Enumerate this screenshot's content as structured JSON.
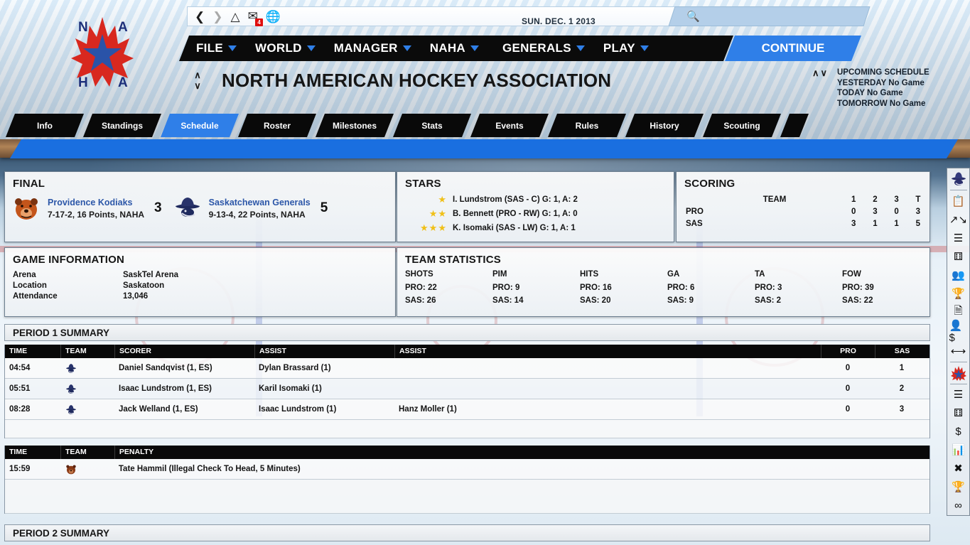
{
  "topbar": {
    "icons": [
      "back-arrow",
      "forward-arrow",
      "home",
      "mail",
      "globe"
    ],
    "mail_badge": "4",
    "date": "SUN. DEC. 1 2013",
    "search_placeholder": ""
  },
  "menu": {
    "items": [
      {
        "label": "FILE",
        "caret": true
      },
      {
        "label": "WORLD",
        "caret": true
      },
      {
        "label": "MANAGER",
        "caret": true
      },
      {
        "label": "NAHA",
        "caret": true
      },
      {
        "label": "GENERALS",
        "caret": true
      },
      {
        "label": "PLAY",
        "caret": true
      }
    ],
    "continue": "CONTINUE"
  },
  "header": {
    "title": "NORTH AMERICAN HOCKEY ASSOCIATION",
    "up_arrow": "∧",
    "down_arrow": "∨",
    "sched_arrows": "∧∨",
    "upcoming": {
      "title": "UPCOMING SCHEDULE",
      "yesterday": "YESTERDAY No Game",
      "today": "TODAY No Game",
      "tomorrow": "TOMORROW No Game"
    }
  },
  "tabs": [
    {
      "label": "Info",
      "active": false
    },
    {
      "label": "Standings",
      "active": false
    },
    {
      "label": "Schedule",
      "active": true
    },
    {
      "label": "Roster",
      "active": false
    },
    {
      "label": "Milestones",
      "active": false
    },
    {
      "label": "Stats",
      "active": false
    },
    {
      "label": "Events",
      "active": false
    },
    {
      "label": "Rules",
      "active": false
    },
    {
      "label": "History",
      "active": false
    },
    {
      "label": "Scouting",
      "active": false
    }
  ],
  "final": {
    "title": "FINAL",
    "away": {
      "name": "Providence Kodiaks",
      "record": "7-17-2, 16 Points, NAHA",
      "score": "3",
      "logo": "kodiaks-bear-logo"
    },
    "home": {
      "name": "Saskatchewan Generals",
      "record": "9-13-4, 22 Points, NAHA",
      "score": "5",
      "logo": "generals-cowboy-logo"
    }
  },
  "stars": {
    "title": "STARS",
    "rows": [
      {
        "stars": "★",
        "text": "I. Lundstrom (SAS - C)  G: 1,  A: 2"
      },
      {
        "stars": "★★",
        "text": "B. Bennett (PRO - RW)  G: 1,  A: 0"
      },
      {
        "stars": "★★★",
        "text": "K. Isomaki (SAS - LW)  G: 1,  A: 1"
      }
    ]
  },
  "scoring": {
    "title": "SCORING",
    "team_header": "TEAM",
    "period_headers": [
      "1",
      "2",
      "3",
      "T"
    ],
    "rows": [
      {
        "team": "PRO",
        "periods": [
          "0",
          "3",
          "0"
        ],
        "total": "3"
      },
      {
        "team": "SAS",
        "periods": [
          "3",
          "1",
          "1"
        ],
        "total": "5"
      }
    ]
  },
  "game_information": {
    "title": "GAME INFORMATION",
    "rows": [
      {
        "key": "Arena",
        "value": "SaskTel Arena"
      },
      {
        "key": "Location",
        "value": "Saskatoon"
      },
      {
        "key": "Attendance",
        "value": "13,046"
      }
    ]
  },
  "team_statistics": {
    "title": "TEAM STATISTICS",
    "columns": [
      {
        "head": "SHOTS",
        "pro": "PRO: 22",
        "sas": "SAS: 26"
      },
      {
        "head": "PIM",
        "pro": "PRO: 9",
        "sas": "SAS: 14"
      },
      {
        "head": "HITS",
        "pro": "PRO: 16",
        "sas": "SAS: 20"
      },
      {
        "head": "GA",
        "pro": "PRO: 6",
        "sas": "SAS: 9"
      },
      {
        "head": "TA",
        "pro": "PRO: 3",
        "sas": "SAS: 2"
      },
      {
        "head": "FOW",
        "pro": "PRO: 39",
        "sas": "SAS: 22"
      }
    ]
  },
  "period1": {
    "title": "PERIOD 1 SUMMARY",
    "goal_headers": {
      "time": "TIME",
      "team": "TEAM",
      "scorer": "SCORER",
      "assist1": "ASSIST",
      "assist2": "ASSIST",
      "pro": "PRO",
      "sas": "SAS"
    },
    "goals": [
      {
        "time": "04:54",
        "team_logo": "generals-cowboy-logo",
        "scorer": "Daniel Sandqvist (1, ES)",
        "assist1": "Dylan Brassard (1)",
        "assist2": "",
        "pro": "0",
        "sas": "1"
      },
      {
        "time": "05:51",
        "team_logo": "generals-cowboy-logo",
        "scorer": "Isaac Lundstrom (1, ES)",
        "assist1": "Karil Isomaki (1)",
        "assist2": "",
        "pro": "0",
        "sas": "2"
      },
      {
        "time": "08:28",
        "team_logo": "generals-cowboy-logo",
        "scorer": "Jack Welland (1, ES)",
        "assist1": "Isaac Lundstrom (1)",
        "assist2": "Hanz Moller (1)",
        "pro": "0",
        "sas": "3"
      }
    ],
    "penalty_headers": {
      "time": "TIME",
      "team": "TEAM",
      "penalty": "PENALTY"
    },
    "penalties": [
      {
        "time": "15:59",
        "team_logo": "kodiaks-bear-logo",
        "penalty": "Tate Hammil (Illegal Check To Head, 5 Minutes)"
      }
    ]
  },
  "period2": {
    "title": "PERIOD 2 SUMMARY"
  },
  "sidebar": {
    "icons": [
      "generals-team-logo",
      "clipboard-icon",
      "transactions-arrow-icon",
      "lines-icon",
      "dice-icon",
      "people-icon",
      "trophy-icon",
      "document-icon",
      "player-finance-icon",
      "trade-arrows-icon",
      "league-logo",
      "list-icon",
      "dice2-icon",
      "dollar-icon",
      "bar-chart-icon",
      "crossed-sticks-icon",
      "trophy2-icon",
      "goggles-icon"
    ]
  },
  "colors": {
    "accent_blue": "#2f7fe8",
    "menu_black": "#0b0b0b",
    "link_blue": "#2c57a8",
    "star_gold": "#f0c018",
    "kodiaks": "#d4601f",
    "generals": "#1f2a5e"
  }
}
